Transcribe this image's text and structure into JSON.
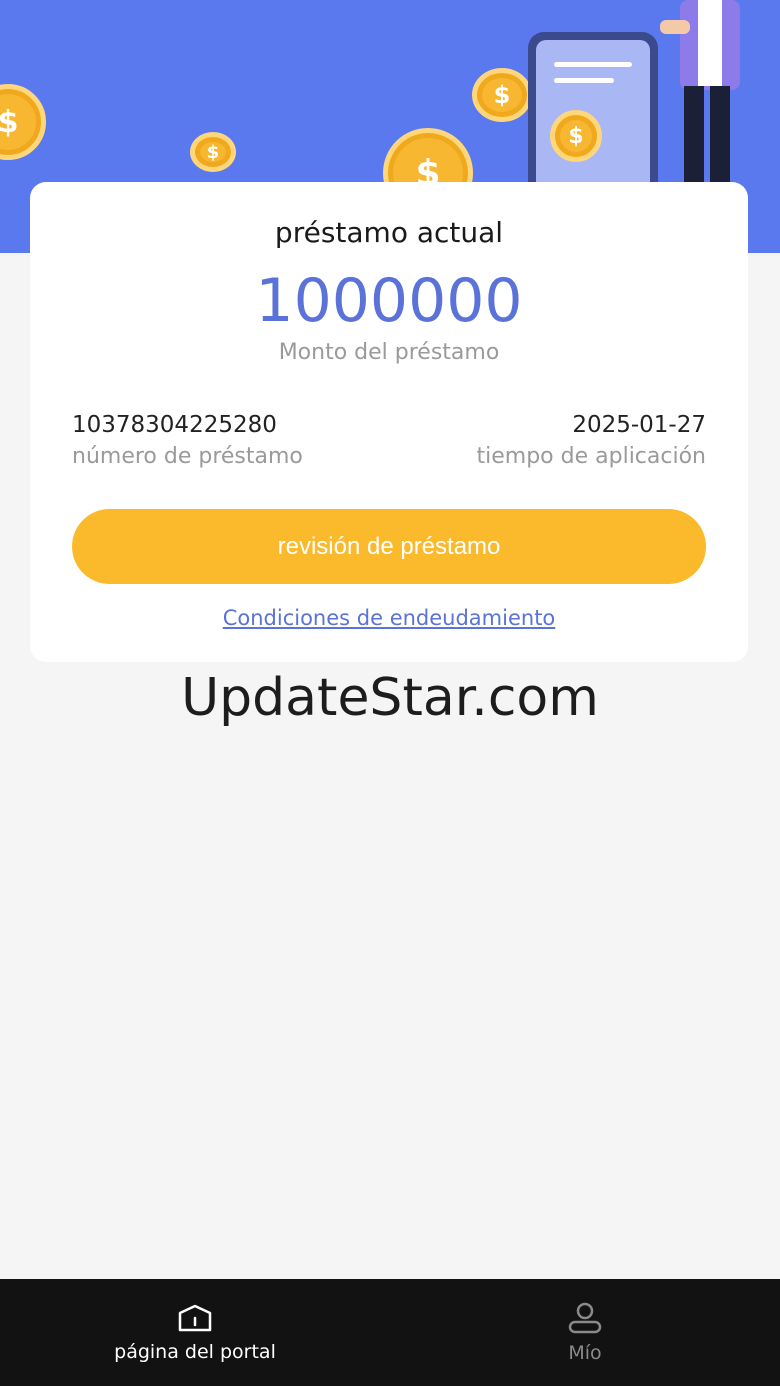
{
  "card": {
    "title": "préstamo actual",
    "amount": "1000000",
    "amount_label": "Monto del préstamo",
    "loan_number": "10378304225280",
    "loan_number_label": "número de préstamo",
    "application_date": "2025-01-27",
    "application_date_label": "tiempo de aplicación",
    "review_button": "revisión de préstamo",
    "terms_link": "Condiciones de endeudamiento"
  },
  "watermark": "UpdateStar.com",
  "bottom_nav": {
    "items": [
      {
        "label": "página del portal",
        "icon": "home-icon",
        "active": true
      },
      {
        "label": "Mío",
        "icon": "user-icon",
        "active": false
      }
    ]
  },
  "colors": {
    "header": "#5b79ee",
    "accent": "#5b72d8",
    "button": "#fbb92c",
    "nav_bg": "#121212"
  }
}
